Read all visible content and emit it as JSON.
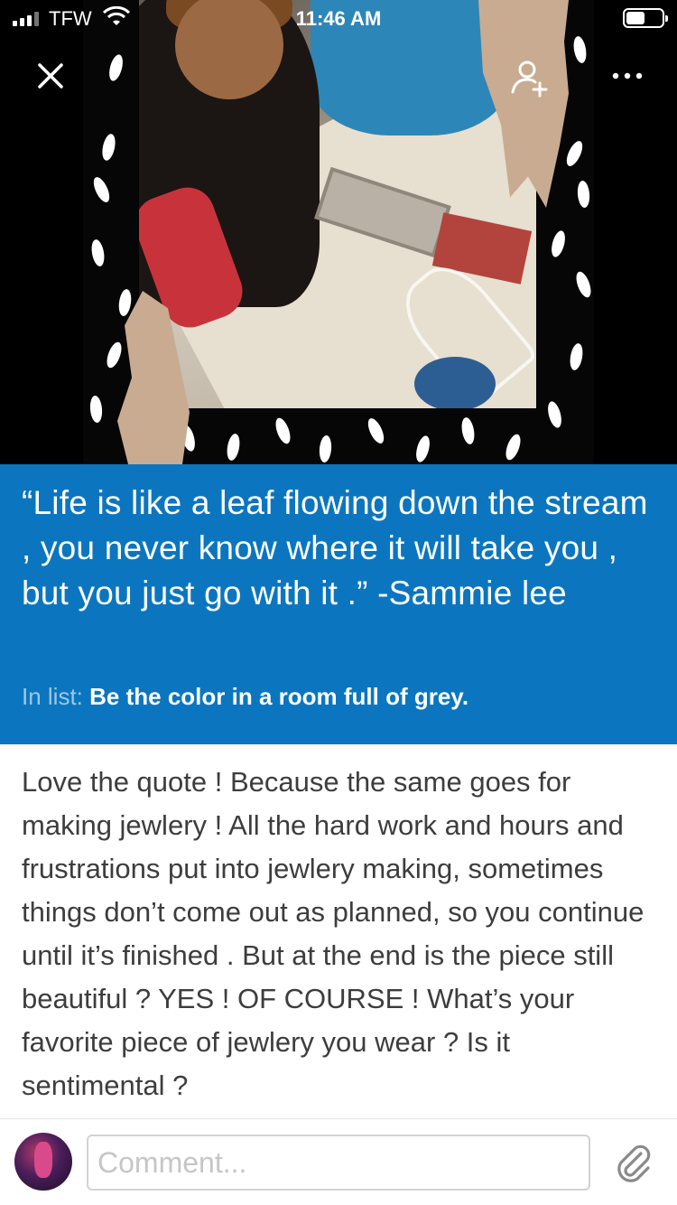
{
  "status_bar": {
    "carrier": "TFW",
    "time": "11:46 AM"
  },
  "toolbar": {
    "close_icon": "close-icon",
    "add_user_icon": "add-user-icon",
    "more_icon": "more-icon"
  },
  "quote": {
    "text": "“Life is like a leaf flowing down the stream , you never know where it will take you , but you just go with it .” -Sammie lee",
    "in_list_label": "In list:",
    "list_name": "Be the color in a room full of grey.",
    "background": "#0b76bf"
  },
  "post": {
    "body": "Love the quote ! Because the same goes for making jewlery ! All the hard work and hours and frustrations put into jewlery making, sometimes things don’t come out as planned, so you continue until it’s finished . But at the end is the piece still beautiful ? YES ! OF COURSE ! What’s your favorite piece of jewlery you wear ? Is it sentimental ?"
  },
  "composer": {
    "placeholder": "Comment...",
    "value": "",
    "attach_icon": "paperclip-icon"
  }
}
